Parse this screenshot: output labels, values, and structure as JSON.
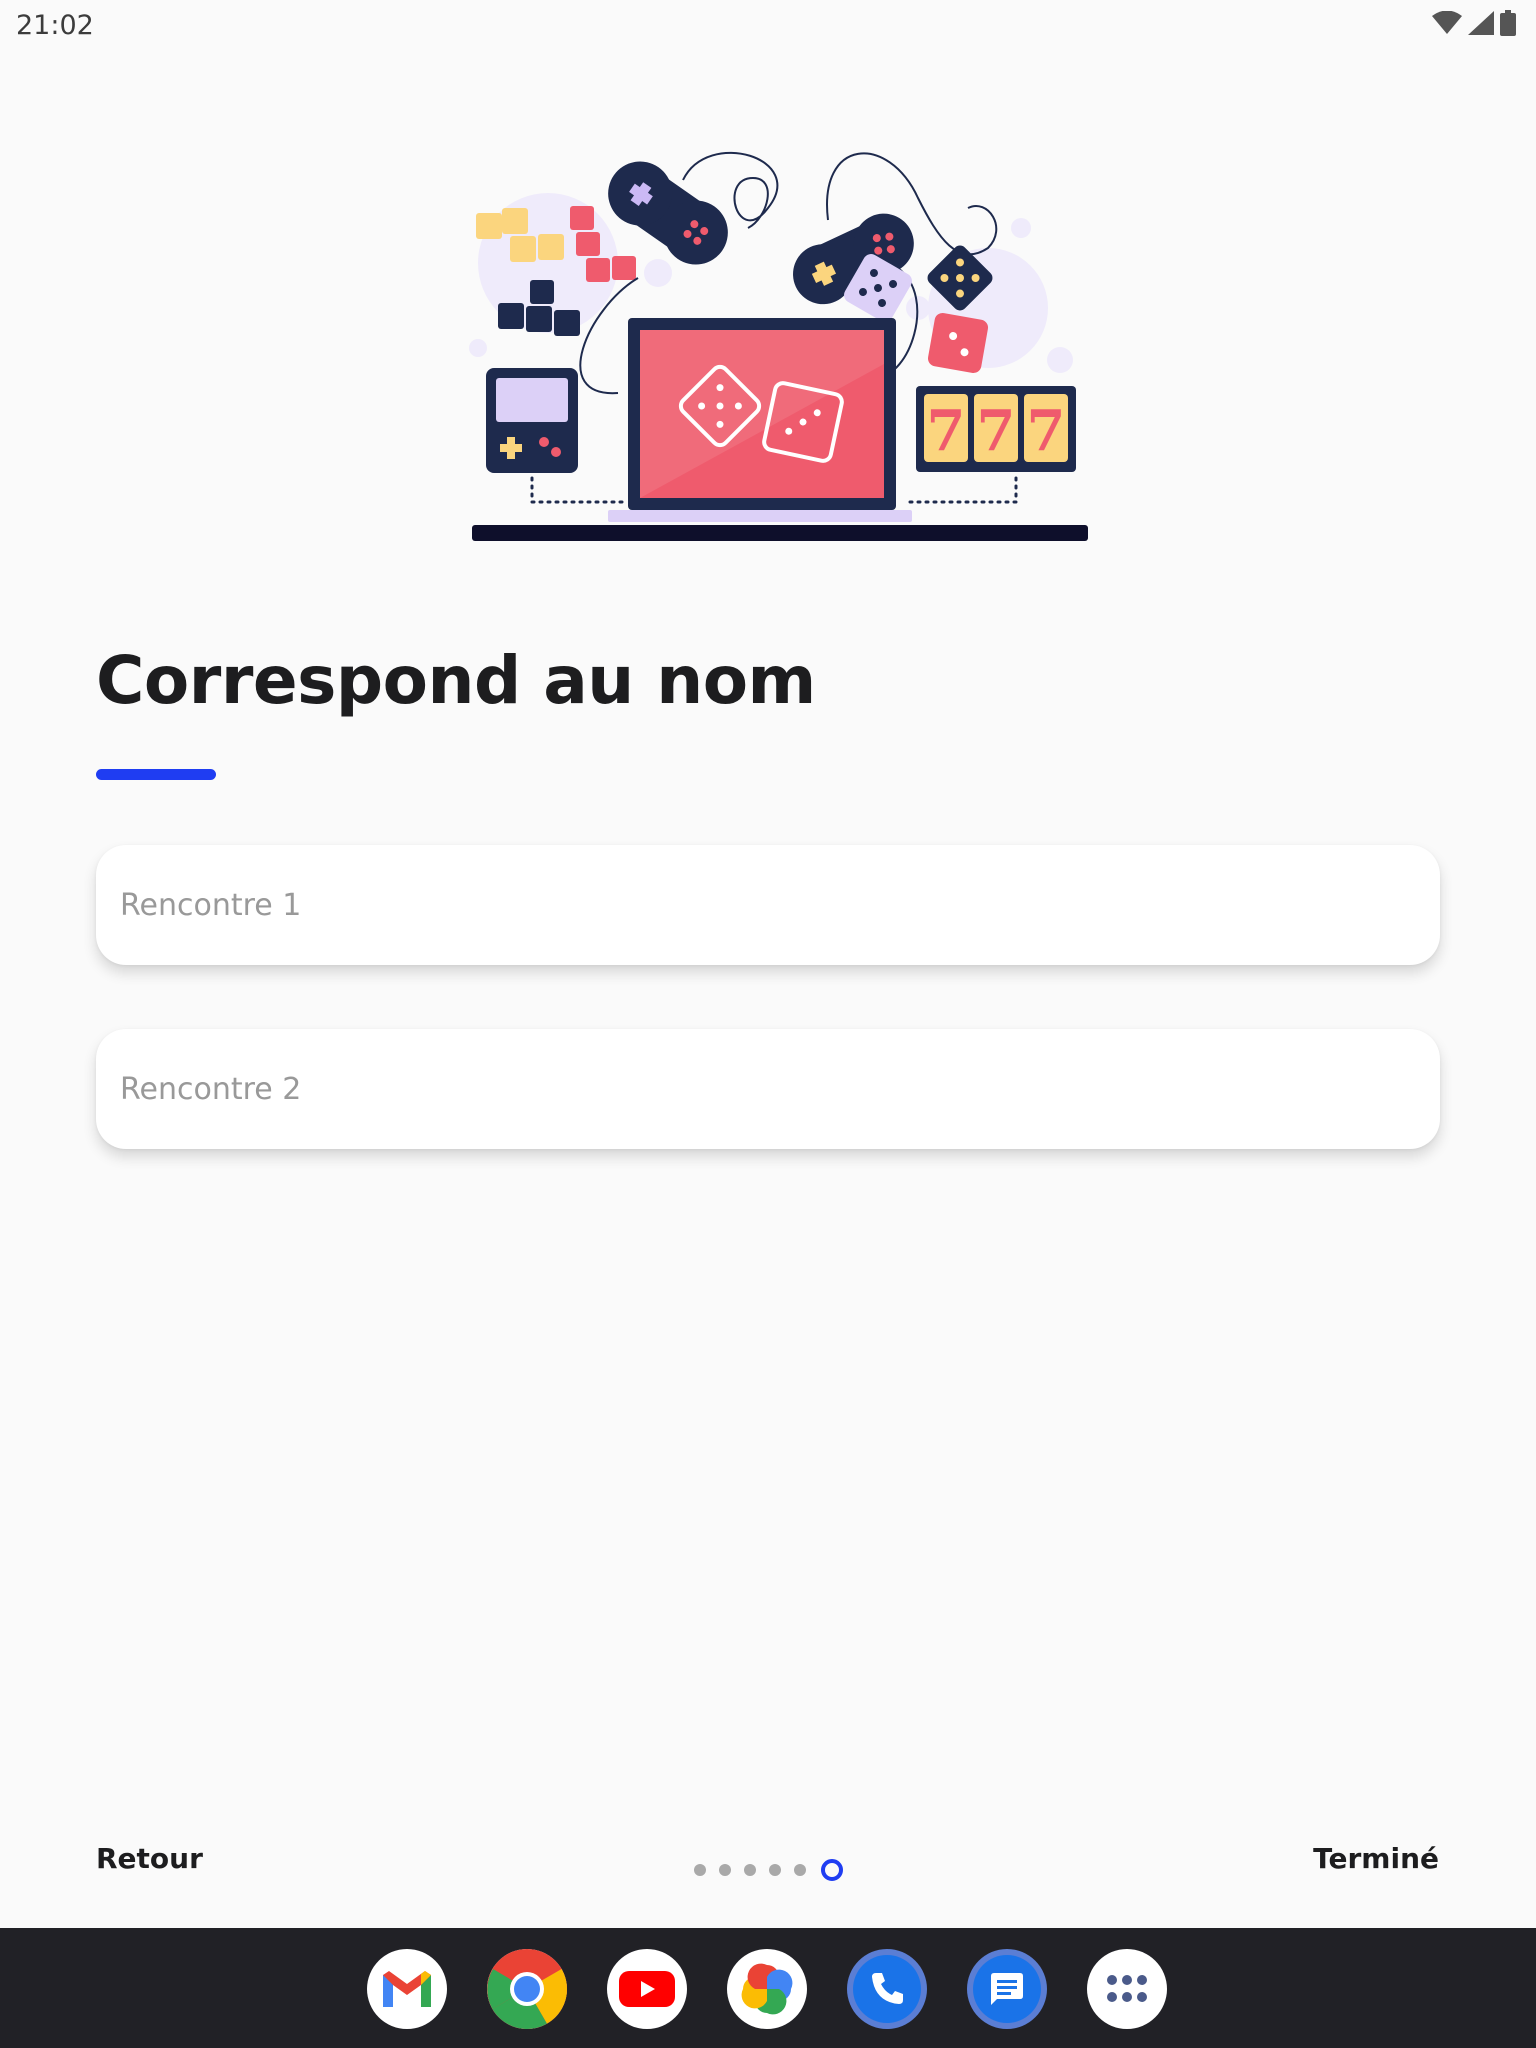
{
  "status_bar": {
    "time": "21:02",
    "icons": [
      "wifi-icon",
      "signal-icon",
      "battery-icon"
    ]
  },
  "illustration": {
    "slot_digits": [
      "7",
      "7",
      "7"
    ]
  },
  "page": {
    "title": "Correspond au nom",
    "accent_color": "#1f3df2"
  },
  "fields": [
    {
      "placeholder": "Rencontre 1",
      "value": ""
    },
    {
      "placeholder": "Rencontre 2",
      "value": ""
    }
  ],
  "footer": {
    "back_label": "Retour",
    "done_label": "Terminé",
    "pager": {
      "total": 6,
      "current": 6
    }
  },
  "taskbar": {
    "apps": [
      "gmail-icon",
      "chrome-icon",
      "youtube-icon",
      "photos-icon",
      "phone-icon",
      "messages-icon",
      "app-drawer-icon"
    ]
  }
}
